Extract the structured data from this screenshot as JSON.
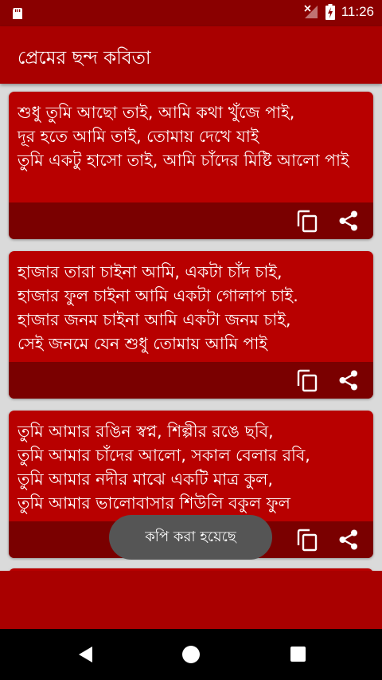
{
  "status_bar": {
    "time": "11:26",
    "icons": [
      "sd-card-icon",
      "no-signal-icon",
      "battery-charging-icon"
    ]
  },
  "app_bar": {
    "title": "প্রেমের ছন্দ কবিতা"
  },
  "poems": [
    {
      "text": "শুধু তুমি আছো তাই, আমি কথা খুঁজে পাই,\nদূর হতে আমি তাই, তোমায় দেখে যাই\nতুমি একটু হাসো তাই, আমি চাঁদের মিষ্টি আলো পাই"
    },
    {
      "text": "হাজার তারা চাইনা আমি, একটা চাঁদ চাই,\nহাজার ফুল চাইনা আমি একটা গোলাপ চাই.\nহাজার জনম চাইনা আমি একটা জনম চাই,\nসেই জনমে যেন শুধু তোমায় আমি পাই"
    },
    {
      "text": "তুমি আমার রঙিন স্বপ্ন, শিল্পীর রঙে ছবি,\nতুমি আমার চাঁদের আলো, সকাল বেলার রবি,\nতুমি আমার নদীর মাঝে একটি মাত্র কুল,\nতুমি আমার ভালোবাসার শিউলি বকুল ফুল"
    }
  ],
  "actions": {
    "copy_icon": "copy-icon",
    "share_icon": "share-icon"
  },
  "toast": {
    "message": "কপি করা হয়েছে"
  },
  "colors": {
    "status_bar": "#8a0000",
    "app_bar": "#a90000",
    "card": "#b80000",
    "card_actions": "#7a0000",
    "background": "#dadada"
  }
}
